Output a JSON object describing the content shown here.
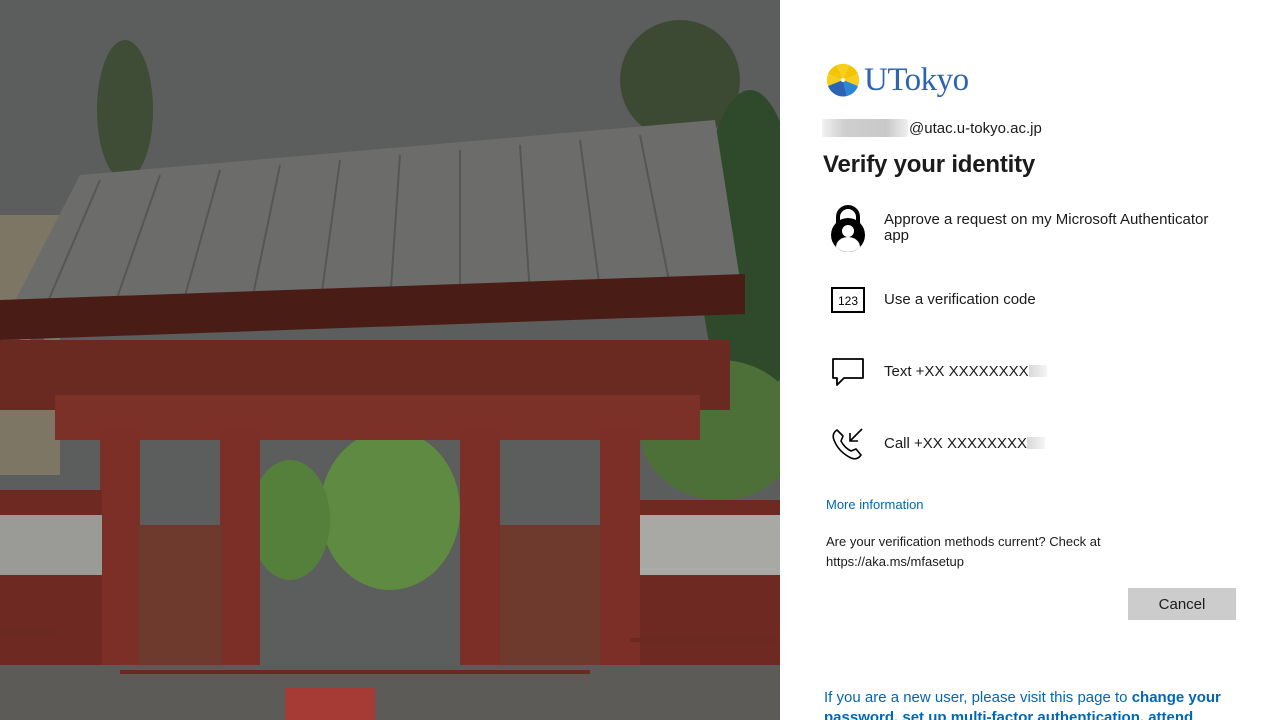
{
  "brand": {
    "name": "UTokyo",
    "accent_color": "#2b63b5"
  },
  "account": {
    "email_domain": "@utac.u-tokyo.ac.jp"
  },
  "page_title": "Verify your identity",
  "options": [
    {
      "icon": "authenticator-lock-icon",
      "label": "Approve a request on my Microsoft Authenticator app"
    },
    {
      "icon": "verification-code-icon",
      "icon_text": "123",
      "label": "Use a verification code"
    },
    {
      "icon": "text-message-icon",
      "label": "Text +XX XXXXXXXX"
    },
    {
      "icon": "phone-call-icon",
      "label": "Call +XX XXXXXXXX"
    }
  ],
  "more_info_link": "More information",
  "check_text": "Are your verification methods current? Check at https://aka.ms/mfasetup",
  "cancel_label": "Cancel",
  "footer": {
    "prefix": "If you are a new user, please visit this page to ",
    "link": "change your password, set up multi-factor authentication, attend"
  },
  "colors": {
    "link": "#0067b8",
    "button_bg": "#cccccc",
    "text": "#1b1b1b"
  }
}
